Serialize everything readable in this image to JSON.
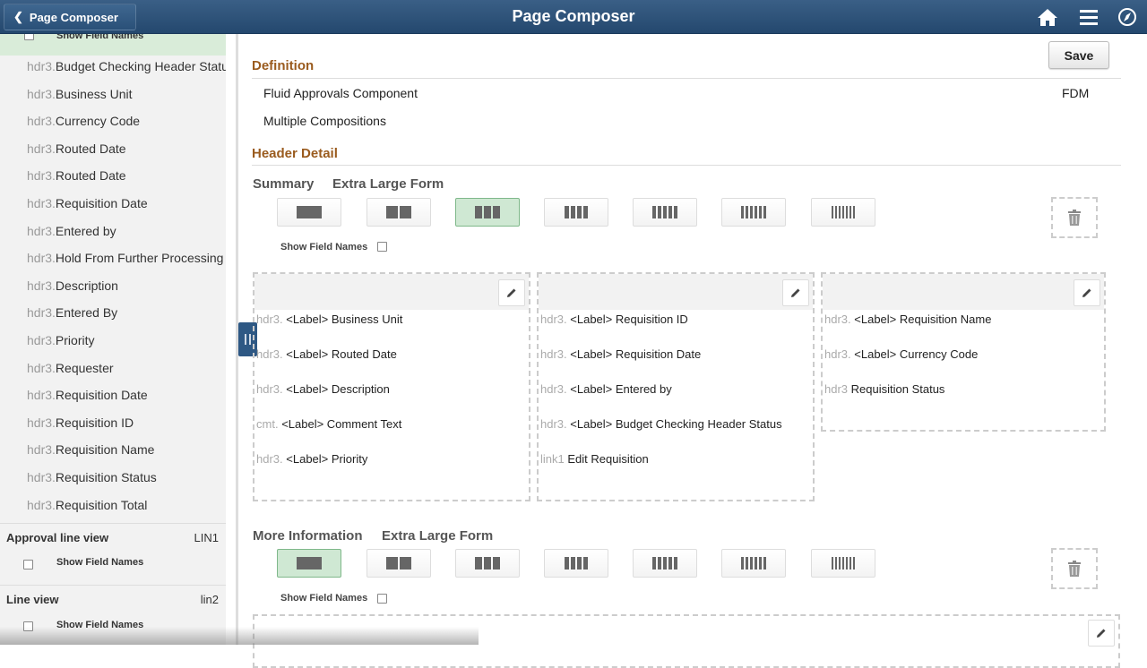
{
  "header": {
    "back_label": "Page Composer",
    "title": "Page Composer",
    "icons": [
      "home-icon",
      "menu-icon",
      "compass-icon"
    ]
  },
  "left_panel": {
    "top_show_field_names": "Show Field Names",
    "items": [
      {
        "prefix": "hdr3.",
        "label": "Budget Checking Header Status"
      },
      {
        "prefix": "hdr3.",
        "label": "Business Unit"
      },
      {
        "prefix": "hdr3.",
        "label": "Currency Code"
      },
      {
        "prefix": "hdr3.",
        "label": "Routed Date"
      },
      {
        "prefix": "hdr3.",
        "label": "Routed Date"
      },
      {
        "prefix": "hdr3.",
        "label": "Requisition Date"
      },
      {
        "prefix": "hdr3.",
        "label": "Entered by"
      },
      {
        "prefix": "hdr3.",
        "label": "Hold From Further Processing"
      },
      {
        "prefix": "hdr3.",
        "label": "Description"
      },
      {
        "prefix": "hdr3.",
        "label": "Entered By"
      },
      {
        "prefix": "hdr3.",
        "label": "Priority"
      },
      {
        "prefix": "hdr3.",
        "label": "Requester"
      },
      {
        "prefix": "hdr3.",
        "label": "Requisition Date"
      },
      {
        "prefix": "hdr3.",
        "label": "Requisition ID"
      },
      {
        "prefix": "hdr3.",
        "label": "Requisition Name"
      },
      {
        "prefix": "hdr3.",
        "label": "Requisition Status"
      },
      {
        "prefix": "hdr3.",
        "label": "Requisition Total"
      }
    ],
    "approval_line": {
      "title": "Approval line view",
      "code": "LIN1",
      "show_field_names": "Show Field Names"
    },
    "line_view": {
      "title": "Line view",
      "code": "lin2",
      "show_field_names": "Show Field Names"
    }
  },
  "main": {
    "save_label": "Save",
    "definition": {
      "title": "Definition",
      "component": "Fluid Approvals Component",
      "component_code": "FDM",
      "compositions": "Multiple Compositions"
    },
    "header_detail": {
      "title": "Header Detail",
      "summary": {
        "name": "Summary",
        "form": "Extra Large Form",
        "selected_columns": 3,
        "show_field_names": "Show Field Names"
      },
      "columns": [
        [
          {
            "prefix": "hdr3.",
            "label": "<Label> Business Unit"
          },
          {
            "prefix": "hdr3.",
            "label": "<Label> Routed Date"
          },
          {
            "prefix": "hdr3.",
            "label": "<Label> Description"
          },
          {
            "prefix": "cmt.",
            "label": "<Label> Comment Text"
          },
          {
            "prefix": "hdr3.",
            "label": "<Label> Priority"
          }
        ],
        [
          {
            "prefix": "hdr3.",
            "label": "<Label> Requisition ID"
          },
          {
            "prefix": "hdr3.",
            "label": "<Label> Requisition Date"
          },
          {
            "prefix": "hdr3.",
            "label": "<Label> Entered by"
          },
          {
            "prefix": "hdr3.",
            "label": "<Label> Budget Checking Header Status"
          },
          {
            "prefix": "link1",
            "label": "Edit Requisition"
          }
        ],
        [
          {
            "prefix": "hdr3.",
            "label": "<Label> Requisition Name"
          },
          {
            "prefix": "hdr3.",
            "label": "<Label> Currency Code"
          },
          {
            "prefix": "hdr3",
            "label": "Requisition Status"
          }
        ]
      ],
      "more_info": {
        "name": "More Information",
        "form": "Extra Large Form",
        "selected_columns": 1,
        "show_field_names": "Show Field Names"
      }
    },
    "colors": {
      "section_title": "#9a5b1e",
      "selected_layout": "#cfe8d3",
      "header_bg": "#2d5580"
    }
  }
}
